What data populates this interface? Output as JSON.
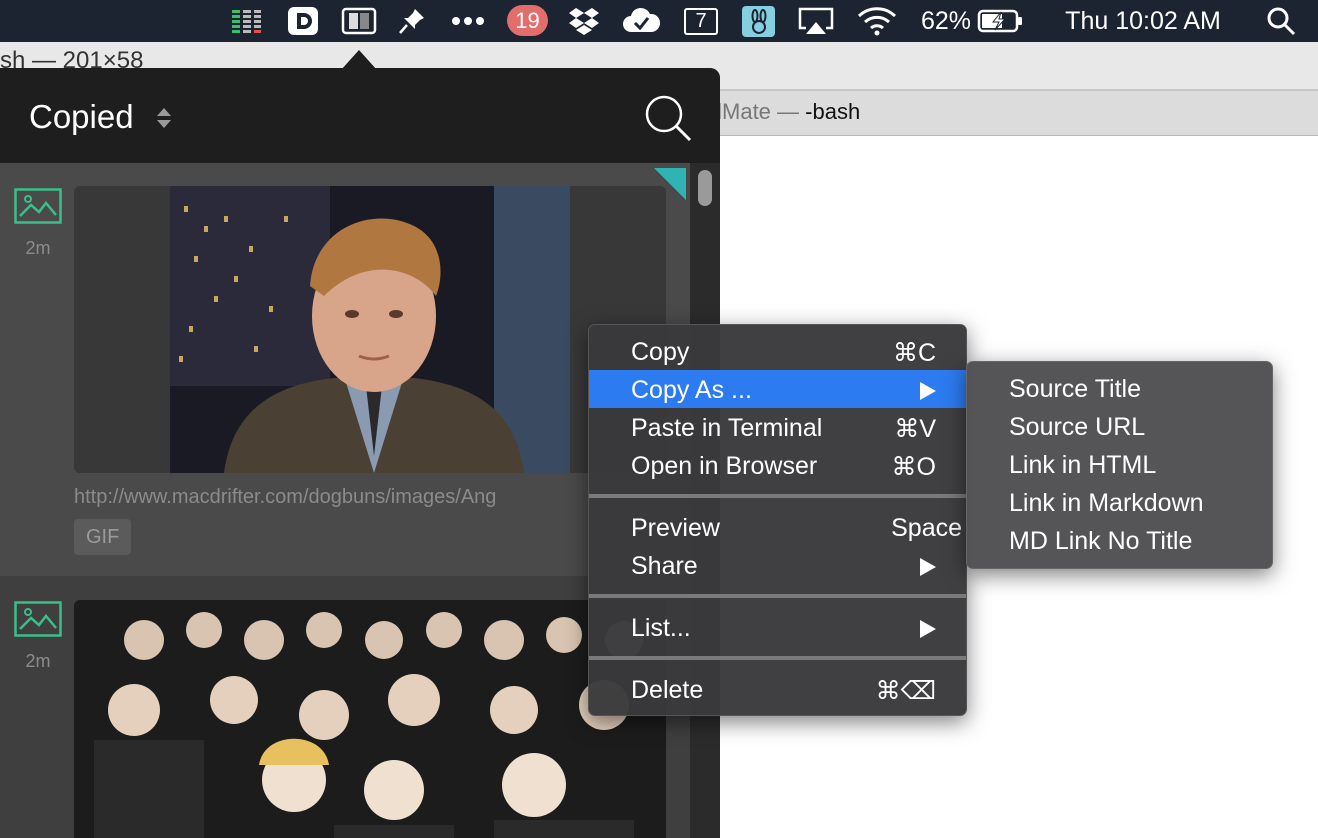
{
  "menubar": {
    "badge_count": "19",
    "calendar_day": "7",
    "battery": "62%",
    "clock": "Thu 10:02 AM",
    "icons": [
      "stacks-icon",
      "d-icon",
      "split-window-icon",
      "pin-icon",
      "more-icon",
      "dropbox-icon",
      "cloud-check-icon",
      "calendar-icon",
      "bunny-icon",
      "airplay-icon",
      "wifi-icon",
      "battery-icon",
      "search-icon"
    ]
  },
  "terminal": {
    "title": "sh — 201×58",
    "tab_prefix": "ailMate — ",
    "tab_active": "-bash"
  },
  "panel": {
    "title": "Copied",
    "clips": [
      {
        "age": "2m",
        "url": "http://www.macdrifter.com/dogbuns/images/Ang",
        "tag": "GIF"
      },
      {
        "age": "2m"
      }
    ]
  },
  "context_menu": {
    "items": [
      {
        "label": "Copy",
        "shortcut": "⌘C"
      },
      {
        "label": "Copy As ...",
        "submenu": true,
        "highlighted": true
      },
      {
        "label": "Paste in Terminal",
        "shortcut": "⌘V"
      },
      {
        "label": "Open in Browser",
        "shortcut": "⌘O"
      },
      {
        "label": "Preview",
        "shortcut": "Space"
      },
      {
        "label": "Share",
        "submenu": true
      },
      {
        "label": "List...",
        "submenu": true
      },
      {
        "label": "Delete",
        "shortcut": "⌘⌫"
      }
    ],
    "submenu": [
      "Source Title",
      "Source URL",
      "Link in HTML",
      "Link in Markdown",
      "MD Link No Title"
    ]
  },
  "colors": {
    "menubar": "#1b2430",
    "highlight": "#2d7bf0",
    "image_icon": "#3bbf8a",
    "corner_flag": "#2fb3b3",
    "badge": "#e26d6a"
  }
}
